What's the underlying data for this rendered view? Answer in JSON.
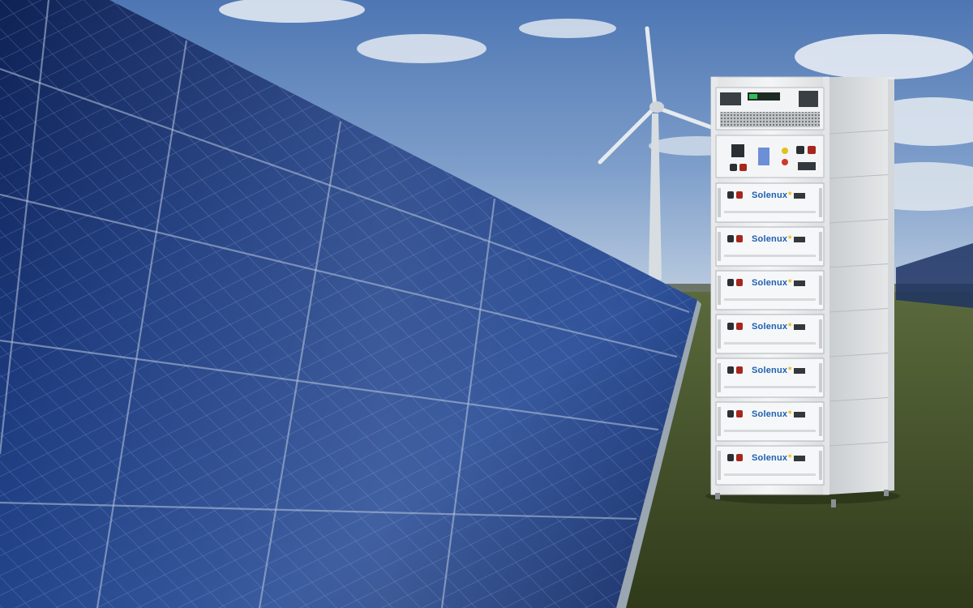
{
  "brand": {
    "name": "Solenux",
    "color": "#1d5fb0",
    "accent": "#f0b400"
  },
  "battery_modules": [
    {
      "label": "Solenux"
    },
    {
      "label": "Solenux"
    },
    {
      "label": "Solenux"
    },
    {
      "label": "Solenux"
    },
    {
      "label": "Solenux"
    },
    {
      "label": "Solenux"
    },
    {
      "label": "Solenux"
    }
  ],
  "colors": {
    "sky_top": "#4d76b3",
    "panel_cell": "#1f3b7a",
    "grass": "#3c4a22",
    "cabinet": "#eef0f1"
  }
}
